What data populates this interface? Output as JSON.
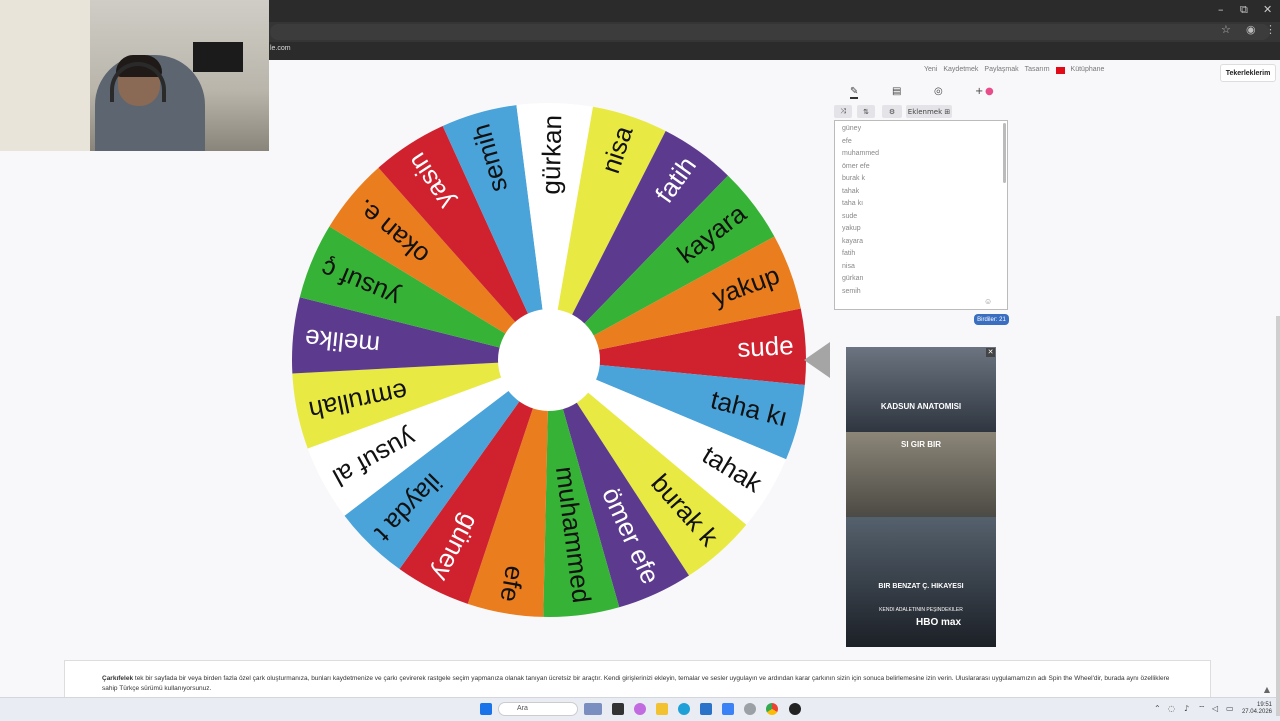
{
  "browser": {
    "url_fragment": "le.com",
    "controls": {
      "minimize": "–",
      "restore": "⧉",
      "close": "✕"
    },
    "addr_icons": {
      "bookmark": "☆",
      "profile": "◉",
      "menu": "⋮"
    }
  },
  "nav": {
    "items": [
      "Yeni",
      "Kaydetmek",
      "Paylaşmak",
      "Tasarım",
      "Kütüphane"
    ],
    "my_wheels": "Tekerleklerim"
  },
  "wheel": {
    "slices": [
      {
        "label": "sude",
        "color": "#d0212f"
      },
      {
        "label": "taha kı",
        "color": "#4aa3d9"
      },
      {
        "label": "tahak",
        "color": "#ffffff"
      },
      {
        "label": "burak k",
        "color": "#e9e944"
      },
      {
        "label": "ömer efe",
        "color": "#5c3b8e"
      },
      {
        "label": "muhammed",
        "color": "#36b336"
      },
      {
        "label": "efe",
        "color": "#ea7d1d"
      },
      {
        "label": "güney",
        "color": "#d0212f"
      },
      {
        "label": "ilayda t",
        "color": "#4aa3d9"
      },
      {
        "label": "yusuf al",
        "color": "#ffffff"
      },
      {
        "label": "emrullah",
        "color": "#e9e944"
      },
      {
        "label": "melike",
        "color": "#5c3b8e"
      },
      {
        "label": "yusuf ç",
        "color": "#36b336"
      },
      {
        "label": "okan e.",
        "color": "#ea7d1d"
      },
      {
        "label": "yasin",
        "color": "#d0212f"
      },
      {
        "label": "semih",
        "color": "#4aa3d9"
      },
      {
        "label": "gürkan",
        "color": "#ffffff"
      },
      {
        "label": "nisa",
        "color": "#e9e944"
      },
      {
        "label": "fatih",
        "color": "#5c3b8e"
      },
      {
        "label": "kayara",
        "color": "#36b336"
      },
      {
        "label": "yakup",
        "color": "#ea7d1d"
      }
    ]
  },
  "panel": {
    "tools": {
      "edit": "✎",
      "clipboard": "▤",
      "hide": "◎",
      "add": "+",
      "color": "●"
    },
    "actions": {
      "shuffle": "⤨",
      "sort": "⇅",
      "settings": "⚙",
      "extensions": "Eklenmek ⊞"
    },
    "entries": [
      "güney",
      "efe",
      "muhammed",
      "ömer efe",
      "burak k",
      "tahak",
      "taha kı",
      "sude",
      "yakup",
      "kayara",
      "fatih",
      "nisa",
      "gürkan",
      "semih"
    ],
    "entries_footer_icon": "☺",
    "count": "Birdiler: 21"
  },
  "ad": {
    "close": "✕",
    "titles": [
      "KADSUN ANATOMISI",
      "SI GIR BIR",
      "BIR BENZAT Ç. HIKAYESI"
    ],
    "brand": "HBO max",
    "tagline": "KENDI ADALETININ PEŞINDEKILER"
  },
  "info": {
    "brand": "Çarkıfelek",
    "text": " tek bir sayfada bir veya birden fazla özel çark oluşturmanıza, bunları kaydetmenize ve çarkı çevirerek rastgele seçim yapmanıza olanak tanıyan ücretsiz bir araçtır. Kendi girişlerinizi ekleyin, temalar ve sesler uygulayın ve ardından karar çarkının sizin için sonuca belirlemesine izin verin. Uluslararası uygulamamızın adı Spin the Wheel'dir, burada aynı özelliklere sahip Türkçe sürümü kullanıyorsunuz."
  },
  "taskbar": {
    "search": "Ara",
    "time": "19:51",
    "date": "27.04.2026"
  }
}
